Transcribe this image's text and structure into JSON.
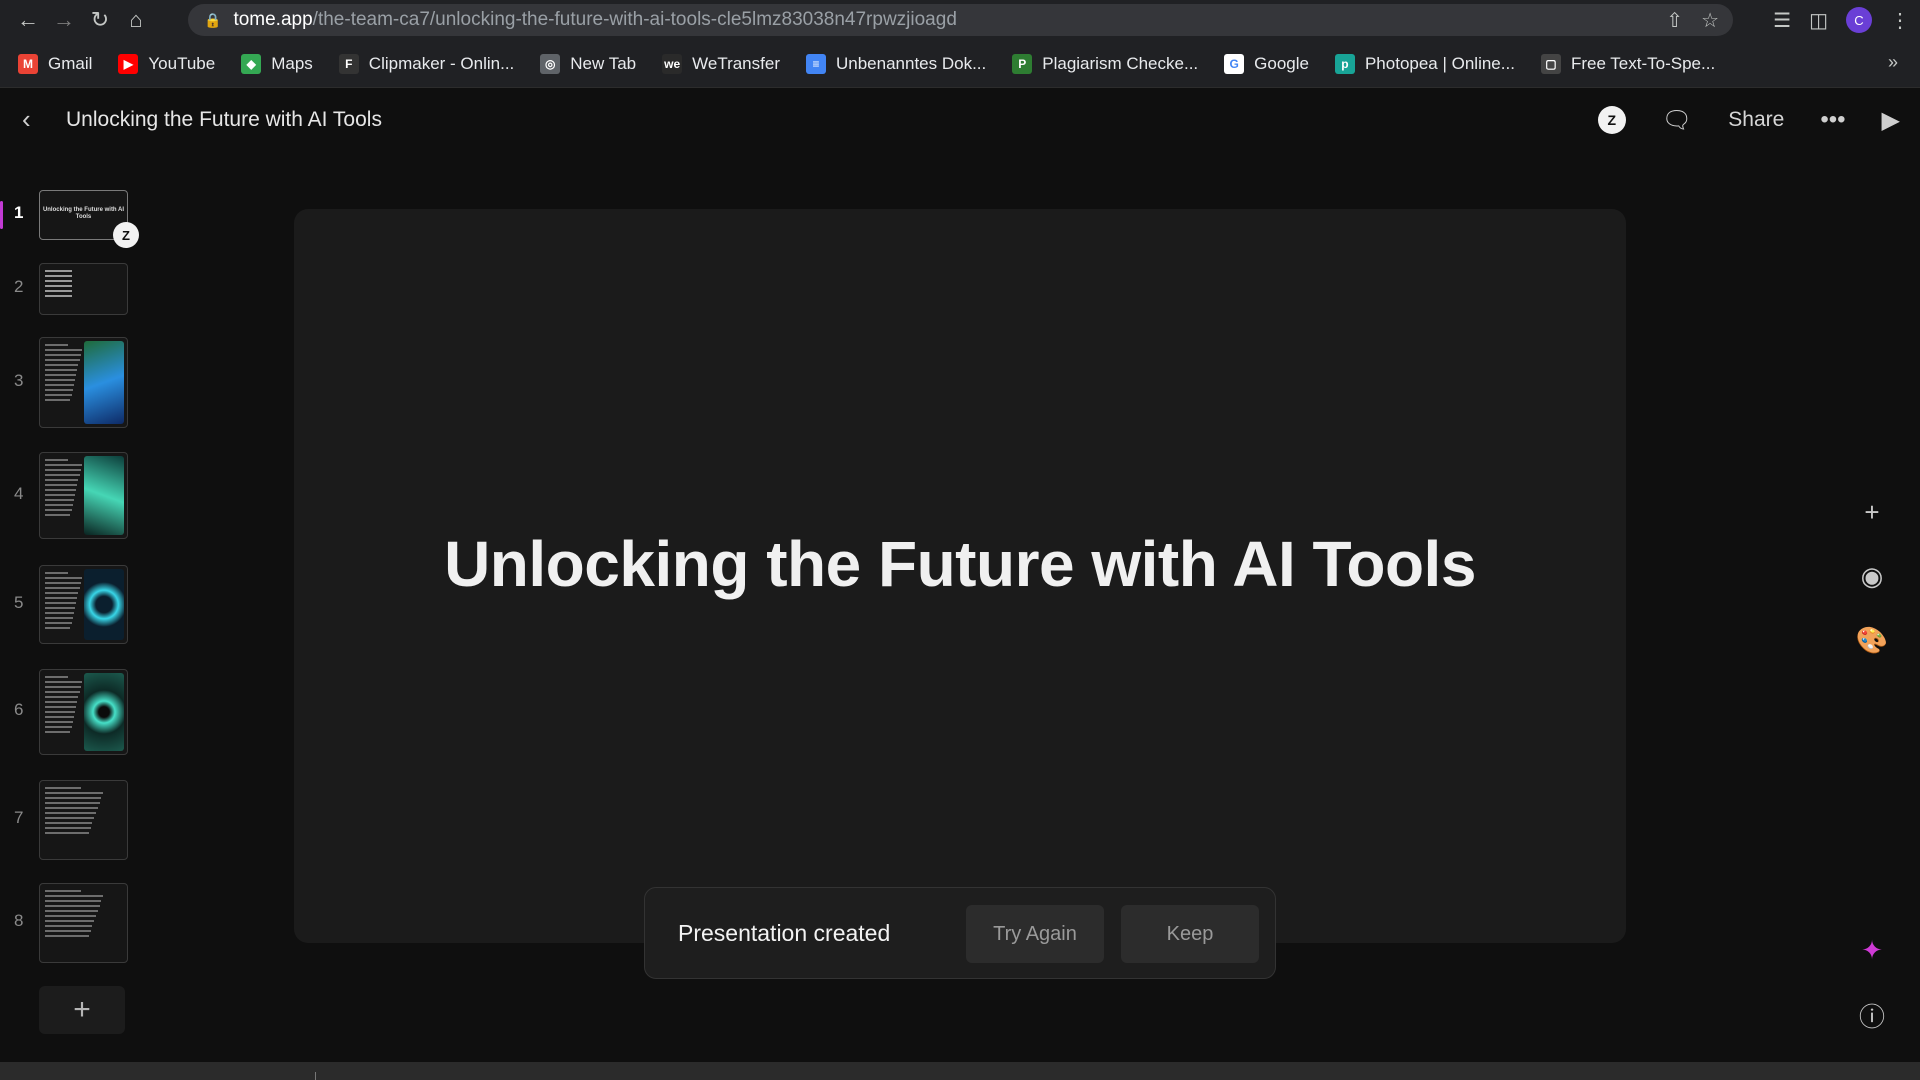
{
  "browser": {
    "url_host": "tome.app",
    "url_path": "/the-team-ca7/unlocking-the-future-with-ai-tools-cle5lmz83038n47rpwzjioagd",
    "profile_initial": "C",
    "bookmarks": [
      {
        "label": "Gmail",
        "icon": "gmail-icon",
        "color": "#ea4335",
        "glyph": "M"
      },
      {
        "label": "YouTube",
        "icon": "youtube-icon",
        "color": "#ff0000",
        "glyph": "▶"
      },
      {
        "label": "Maps",
        "icon": "maps-icon",
        "color": "#34a853",
        "glyph": "◆"
      },
      {
        "label": "Clipmaker - Onlin...",
        "icon": "clipmaker-icon",
        "color": "#333333",
        "glyph": "F"
      },
      {
        "label": "New Tab",
        "icon": "globe-icon",
        "color": "#5f6368",
        "glyph": "◎"
      },
      {
        "label": "WeTransfer",
        "icon": "wetransfer-icon",
        "color": "#2a2a2a",
        "glyph": "we"
      },
      {
        "label": "Unbenanntes Dok...",
        "icon": "google-docs-icon",
        "color": "#4285f4",
        "glyph": "≡"
      },
      {
        "label": "Plagiarism Checke...",
        "icon": "plagiarism-icon",
        "color": "#2e7d32",
        "glyph": "P"
      },
      {
        "label": "Google",
        "icon": "google-icon",
        "color": "#ffffff",
        "glyph": "G"
      },
      {
        "label": "Photopea | Online...",
        "icon": "photopea-icon",
        "color": "#18a497",
        "glyph": "p"
      },
      {
        "label": "Free Text-To-Spe...",
        "icon": "tts-icon",
        "color": "#444444",
        "glyph": "▢"
      }
    ]
  },
  "app": {
    "doc_title": "Unlocking the Future with AI Tools",
    "avatar_initial": "Z",
    "share_label": "Share",
    "accent_color": "#c23bd4"
  },
  "slides": {
    "numbers": [
      "1",
      "2",
      "3",
      "4",
      "5",
      "6",
      "7",
      "8"
    ],
    "thumb_title": "Unlocking the Future with AI Tools",
    "active": "1"
  },
  "canvas": {
    "heading": "Unlocking the Future with AI Tools"
  },
  "toast": {
    "message": "Presentation created",
    "try_again": "Try Again",
    "keep": "Keep"
  }
}
